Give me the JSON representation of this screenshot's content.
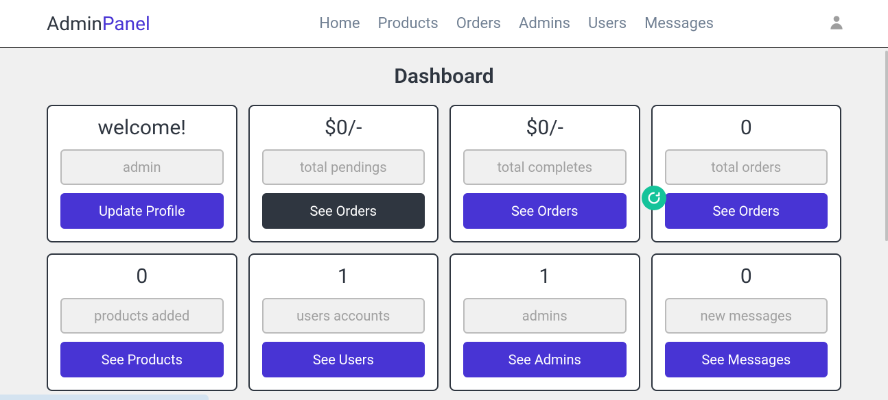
{
  "logo": {
    "part1": "Admin",
    "part2": "Panel"
  },
  "nav": {
    "home": "Home",
    "products": "Products",
    "orders": "Orders",
    "admins": "Admins",
    "users": "Users",
    "messages": "Messages"
  },
  "page_title": "Dashboard",
  "cards": [
    {
      "value": "welcome!",
      "label": "admin",
      "button": "Update Profile",
      "button_style": "primary"
    },
    {
      "value": "$0/-",
      "label": "total pendings",
      "button": "See Orders",
      "button_style": "dark"
    },
    {
      "value": "$0/-",
      "label": "total completes",
      "button": "See Orders",
      "button_style": "primary"
    },
    {
      "value": "0",
      "label": "total orders",
      "button": "See Orders",
      "button_style": "primary"
    },
    {
      "value": "0",
      "label": "products added",
      "button": "See Products",
      "button_style": "primary"
    },
    {
      "value": "1",
      "label": "users accounts",
      "button": "See Users",
      "button_style": "primary"
    },
    {
      "value": "1",
      "label": "admins",
      "button": "See Admins",
      "button_style": "primary"
    },
    {
      "value": "0",
      "label": "new messages",
      "button": "See Messages",
      "button_style": "primary"
    }
  ]
}
